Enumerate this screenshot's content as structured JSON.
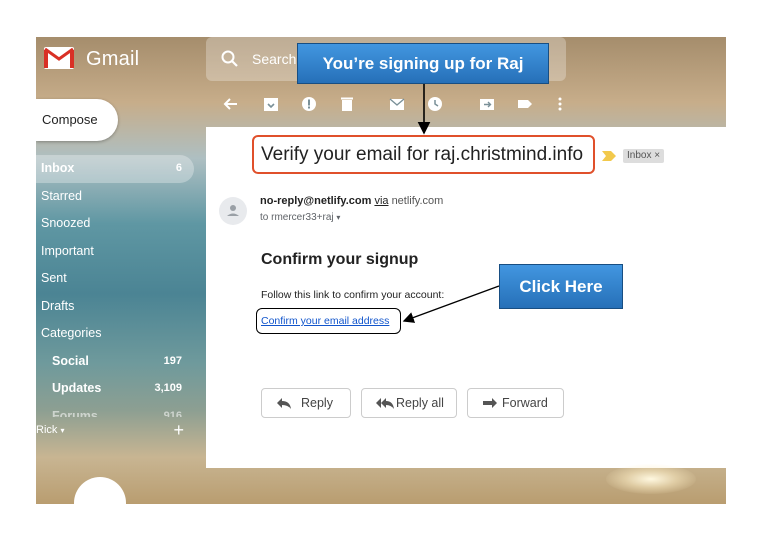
{
  "app": {
    "name": "Gmail"
  },
  "search": {
    "placeholder": "Search"
  },
  "compose": {
    "label": "Compose"
  },
  "sidebar": {
    "items": [
      {
        "label": "Inbox",
        "count": "6",
        "active": true
      },
      {
        "label": "Starred",
        "count": ""
      },
      {
        "label": "Snoozed",
        "count": ""
      },
      {
        "label": "Important",
        "count": ""
      },
      {
        "label": "Sent",
        "count": ""
      },
      {
        "label": "Drafts",
        "count": ""
      },
      {
        "label": "Categories",
        "count": ""
      },
      {
        "label": "Social",
        "count": "197"
      },
      {
        "label": "Updates",
        "count": "3,109"
      },
      {
        "label": "Forums",
        "count": "916"
      }
    ],
    "hangouts_user": "Rick"
  },
  "toolbar": {
    "icons": [
      "back-arrow-icon",
      "archive-icon",
      "report-spam-icon",
      "delete-icon",
      "mark-unread-icon",
      "snooze-icon",
      "move-to-icon",
      "label-icon",
      "more-icon"
    ]
  },
  "email": {
    "subject": "Verify your email for raj.christmind.info",
    "label": "Inbox ×",
    "sender_email": "no-reply@netlify.com",
    "via_word": "via",
    "via_domain": "netlify.com",
    "to": "to rmercer33+raj",
    "heading": "Confirm your signup",
    "body": "Follow this link to confirm your account:",
    "link": "Confirm your email address"
  },
  "actions": {
    "reply": "Reply",
    "reply_all": "Reply all",
    "forward": "Forward"
  },
  "annotations": {
    "top_callout": "You’re signing up for Raj",
    "click_callout": "Click Here",
    "colors": {
      "callout": "#2d7fc9",
      "subject_outline": "#e0502b",
      "link": "#1155cc"
    }
  }
}
